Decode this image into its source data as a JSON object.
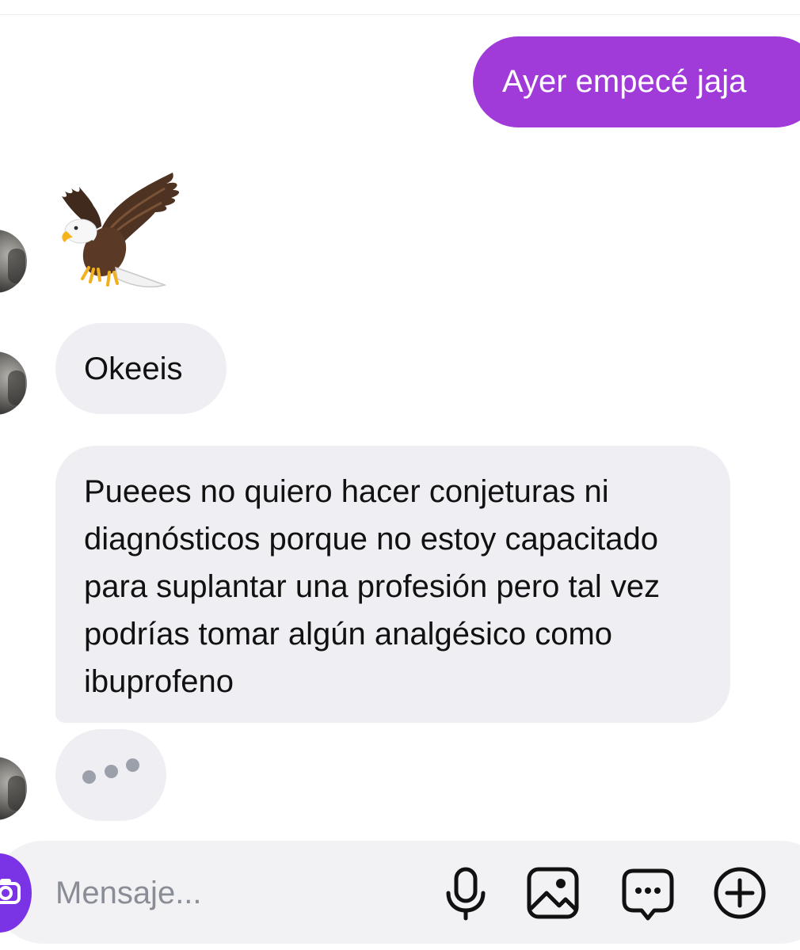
{
  "messages": {
    "outgoing_1": "Ayer empecé jaja",
    "incoming_sticker": "eagle-sticker",
    "incoming_1": "Okeeis",
    "incoming_2": "Pueees no quiero hacer conjeturas ni diagnósticos porque no estoy capacitado para suplantar una profesión pero tal vez podrías tomar algún analgésico como ibuprofeno"
  },
  "composer": {
    "placeholder": "Mensaje...",
    "icons": [
      "camera-icon",
      "microphone-icon",
      "image-icon",
      "message-bubble-icon",
      "plus-circle-icon"
    ]
  },
  "colors": {
    "outgoing_bubble": "#a03ad8",
    "incoming_bubble": "#efeff3",
    "camera_button": "#7a34e6",
    "placeholder_text": "#8a8d96"
  }
}
